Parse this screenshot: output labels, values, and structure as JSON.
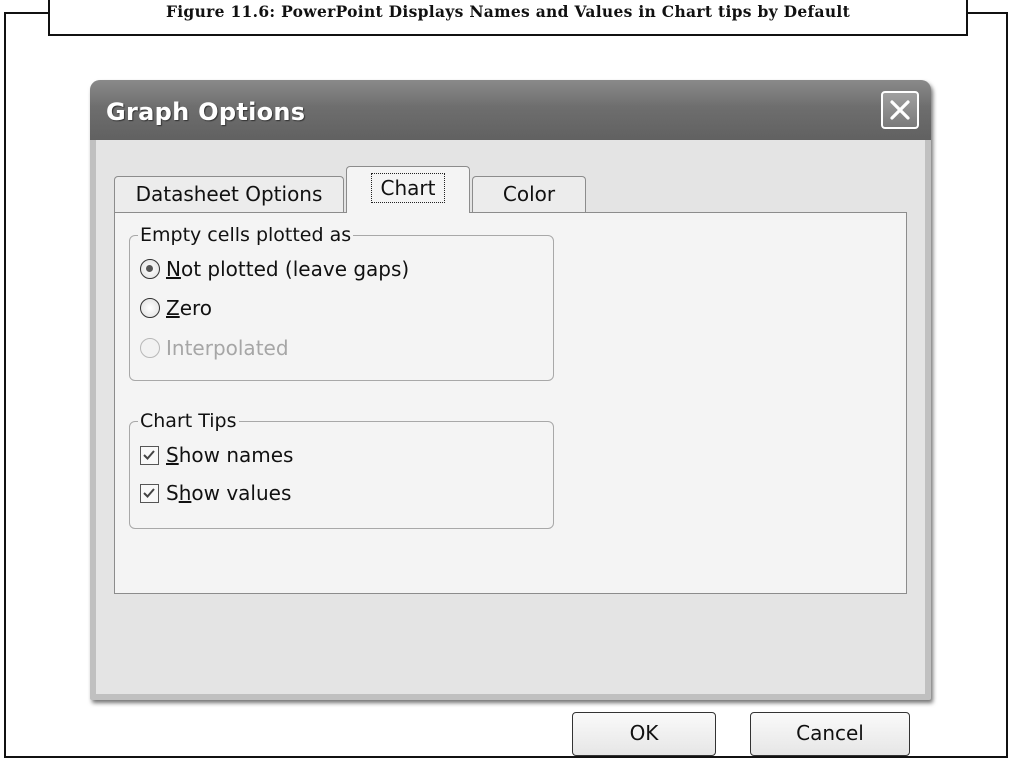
{
  "figure": {
    "caption": "Figure 11.6: PowerPoint Displays Names and Values in Chart tips by Default"
  },
  "dialog": {
    "title": "Graph Options",
    "close_icon": "close-icon",
    "tabs": [
      {
        "label": "Datasheet Options",
        "active": false
      },
      {
        "label": "Chart",
        "active": true
      },
      {
        "label": "Color",
        "active": false
      }
    ],
    "empty_cells": {
      "legend": "Empty cells plotted as",
      "options": [
        {
          "label": "Not plotted (leave gaps)",
          "accel": "N",
          "rest": "ot plotted (leave gaps)",
          "selected": true,
          "enabled": true
        },
        {
          "label": "Zero",
          "accel": "Z",
          "rest": "ero",
          "selected": false,
          "enabled": true
        },
        {
          "label": "Interpolated",
          "selected": false,
          "enabled": false
        }
      ]
    },
    "chart_tips": {
      "legend": "Chart Tips",
      "options": [
        {
          "label": "Show names",
          "accel": "S",
          "rest": "how names",
          "checked": true
        },
        {
          "label": "Show values",
          "pre": "S",
          "accel": "h",
          "rest": "ow values",
          "checked": true
        }
      ]
    },
    "buttons": {
      "ok": "OK",
      "cancel": "Cancel"
    }
  }
}
